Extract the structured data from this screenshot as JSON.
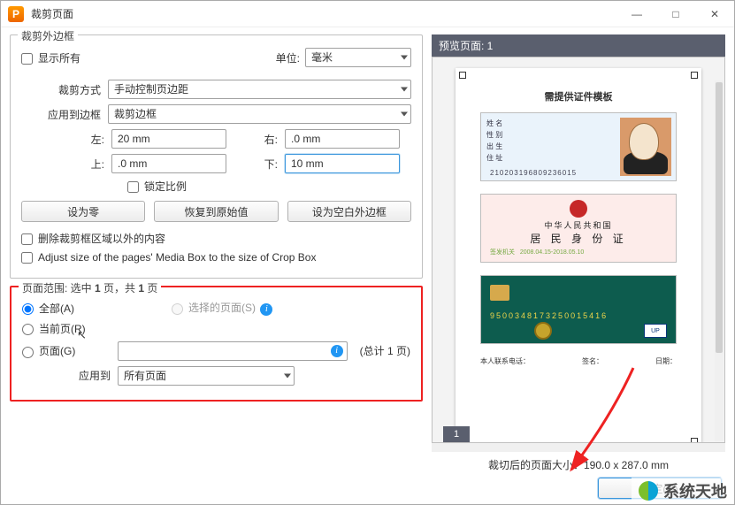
{
  "window": {
    "title": "裁剪页面"
  },
  "winbuttons": {
    "min": "—",
    "max": "□",
    "close": "✕"
  },
  "group_margin": {
    "title": "裁剪外边框",
    "show_all_label": "显示所有",
    "unit_label": "单位:",
    "unit_value": "毫米",
    "crop_method_label": "裁剪方式",
    "crop_method_value": "手动控制页边距",
    "apply_border_label": "应用到边框",
    "apply_border_value": "裁剪边框",
    "left_label": "左:",
    "left_value": "20 mm",
    "right_label": "右:",
    "right_value": ".0 mm",
    "top_label": "上:",
    "top_value": ".0 mm",
    "bottom_label": "下:",
    "bottom_value": "10 mm",
    "lock_ratio_label": "锁定比例",
    "btn_zero": "设为零",
    "btn_reset": "恢复到原始值",
    "btn_blank": "设为空白外边框",
    "remove_outside_label": "删除裁剪框区域以外的内容",
    "adjust_media_label": "Adjust size of the pages' Media Box to the size of Crop Box"
  },
  "group_range": {
    "title_prefix": "页面范围: 选中 ",
    "title_mid": "1",
    "title_suffix": " 页，共 ",
    "title_total": "1",
    "title_end": " 页",
    "opt_all": "全部(A)",
    "opt_selected": "选择的页面(S)",
    "opt_current": "当前页(R)",
    "opt_pages": "页面(G)",
    "pages_value": "",
    "pages_total": "(总计 1 页)",
    "apply_to_label": "应用到",
    "apply_to_value": "所有页面"
  },
  "preview": {
    "header": "预览页面: 1",
    "page_title": "需提供证件模板",
    "id_number": "210203196809236015",
    "cn_line1": "中华人民共和国",
    "cn_line2": "居 民 身 份 证",
    "card3_num": "9500348173250015416",
    "sig_contact": "本人联系电话：",
    "sig_sign": "签名：",
    "sig_date": "日期：",
    "pagenum": "1",
    "crop_size": "裁切后的页面大小：190.0 x 287.0  mm"
  },
  "footer": {
    "ok": "确定(O)"
  },
  "watermark": {
    "text": "系统天地"
  }
}
